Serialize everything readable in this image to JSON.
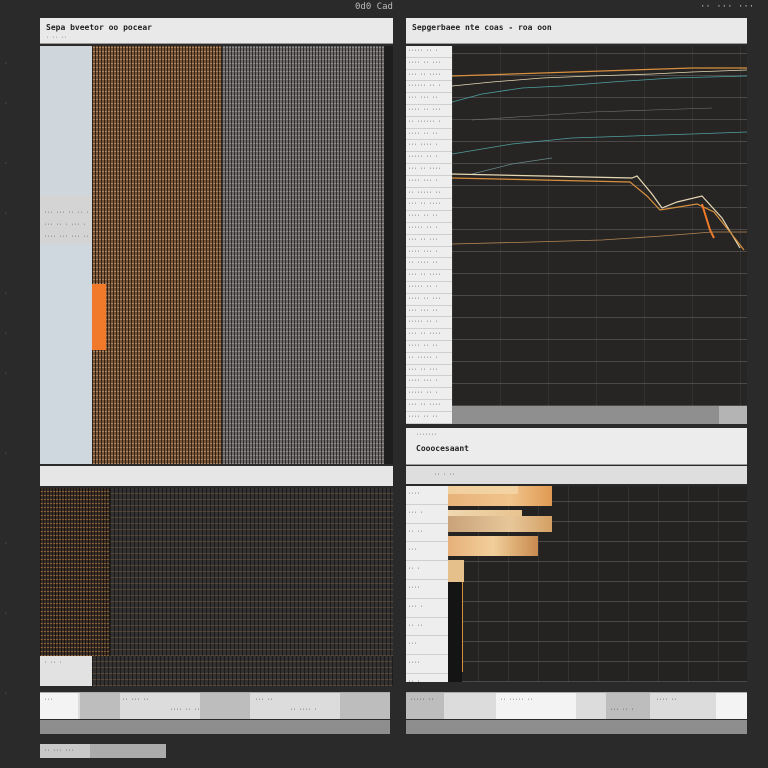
{
  "topbar": {
    "center_text": "0d0 Cad",
    "right_text": "·· ··· ···"
  },
  "left_panel": {
    "title": "Sepa bveetor oo pocear",
    "subtitle": "· ·· ··",
    "left_labels": [
      "··· ··· ·· ·· ·",
      "··· ·· · ··· ·",
      "···· ··· ··· ··"
    ],
    "sub_labels": [
      "· ·· ·"
    ],
    "footer_tabs": [
      "···",
      "·· ··· ··",
      "···· ·· ··",
      "··· ··",
      "·· ···· ·"
    ],
    "status_text": "·· ··· ···"
  },
  "right_top_panel": {
    "title": "Sepgerbaee nte coas  -  roa oon",
    "row_labels": [
      "····· ·· ·",
      "···· ·· ···",
      "··· ·· ····",
      "······ ·· ·",
      "··· ··· ··",
      "···· ·· ···",
      "·· ······ ·",
      "···· ·· ··",
      "··· ···· ·",
      "····· ·· ·",
      "··· ·· ····",
      "···· ··· ·",
      "·· ····· ··",
      "··· ·· ····",
      "···· ·· ··",
      "····· ·· ·",
      "··· ·· ···",
      "···· ··· ·",
      "·· ···· ··",
      "··· ·· ····",
      "····· ·· ·",
      "···· ·· ···",
      "··· ··· ··",
      "····· ·· ·",
      "··· ·· ····",
      "···· ·· ··",
      "·· ····· ·",
      "··· ·· ···",
      "···· ··· ·",
      "····· ·· ·",
      "··· ·· ····",
      "···· ·· ··",
      "·· ··· ···",
      "··· ·· ···",
      "····· ·· ·",
      "··· ·· ···"
    ]
  },
  "right_bottom_panel": {
    "tag": "·······",
    "title": "Cooocesaant",
    "subtitle": "·· · ··",
    "row_labels": [
      "····",
      "··· ·",
      "·· ··",
      "···",
      "·· ·",
      "····",
      "··· ·",
      "·· ··",
      "···",
      "····",
      "·· ·"
    ],
    "footer_text": [
      "····· ··",
      "·· ····· ··",
      "··· ·· ·",
      "···· ··"
    ]
  },
  "colors": {
    "accent_orange": "#f07a2a",
    "line_orange": "#d9903e",
    "line_teal": "#4fa0a0",
    "line_cream": "#e8d9b5",
    "bar_fill": "#d9a56b"
  }
}
